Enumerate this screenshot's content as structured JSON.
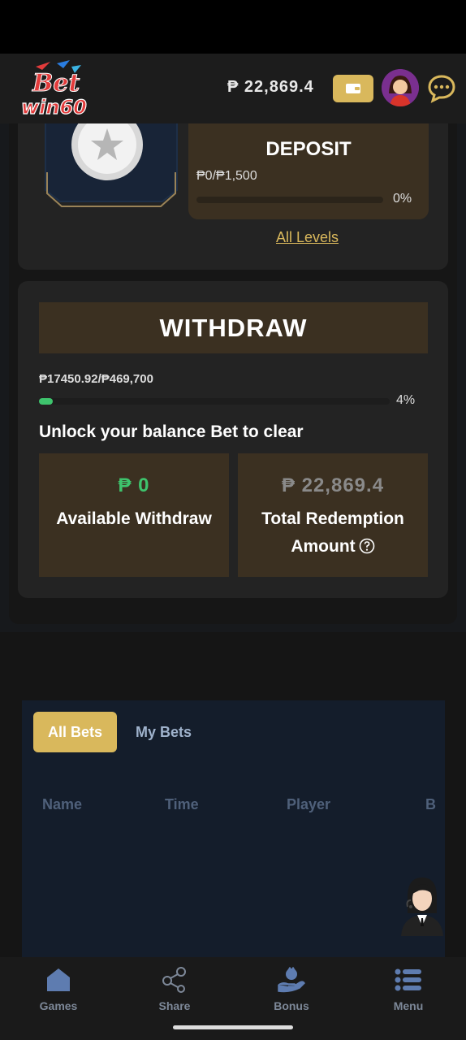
{
  "header": {
    "logo_text_top": "Bet",
    "logo_text_bottom": "win60",
    "balance": "₱ 22,869.4"
  },
  "vip": {
    "deposit_title": "DEPOSIT",
    "deposit_amount": "₱0/₱1,500",
    "deposit_progress": 0,
    "deposit_pct": "0%",
    "all_levels": "All Levels"
  },
  "withdraw": {
    "title": "WITHDRAW",
    "amount": "₱17450.92/₱469,700",
    "progress": 0.04,
    "pct": "4%",
    "unlock_text": "Unlock your balance Bet to clear",
    "available_value": "₱ 0",
    "available_label": "Available Withdraw",
    "total_value": "₱ 22,869.4",
    "total_label": "Total Redemption Amount"
  },
  "bets": {
    "tabs": [
      {
        "label": "All Bets",
        "active": true
      },
      {
        "label": "My Bets",
        "active": false
      }
    ],
    "columns": [
      "Name",
      "Time",
      "Player",
      "B"
    ]
  },
  "nav": [
    {
      "label": "Games",
      "icon": "home-icon"
    },
    {
      "label": "Share",
      "icon": "share-icon"
    },
    {
      "label": "Bonus",
      "icon": "bonus-icon"
    },
    {
      "label": "Menu",
      "icon": "menu-icon"
    }
  ],
  "colors": {
    "accent": "#d9b85c",
    "progress": "#3ec46d",
    "available_value": "#3ec46d",
    "total_value": "#8a8a8a"
  }
}
